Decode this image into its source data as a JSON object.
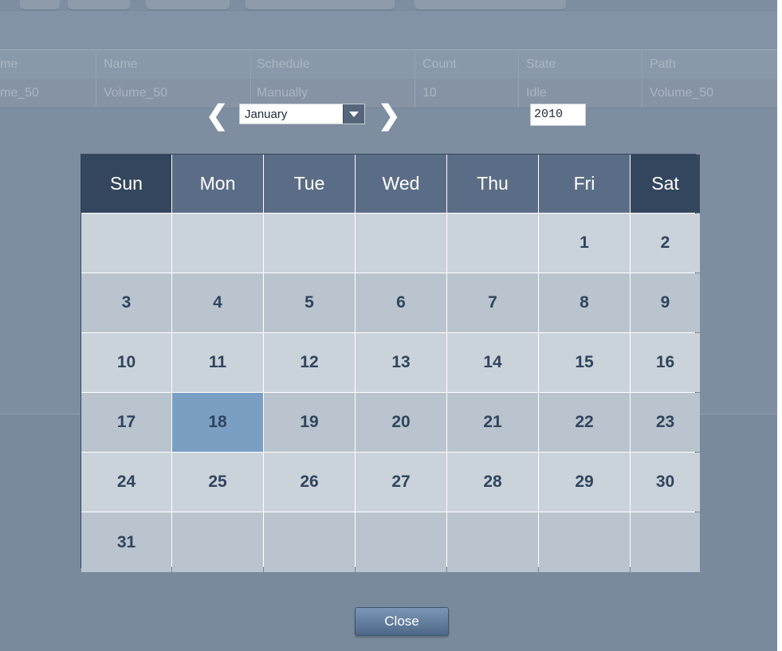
{
  "background": {
    "table": {
      "columns": [
        "me",
        "Name",
        "Schedule",
        "Count",
        "State",
        "Path"
      ],
      "row": [
        "me_50",
        "Volume_50",
        "Manually",
        "10",
        "Idle",
        "Volume_50"
      ]
    }
  },
  "datepicker": {
    "prev_icon": "chevron-left-icon",
    "next_icon": "chevron-right-icon",
    "month": "January",
    "year": "2010",
    "weekdays": [
      "Sun",
      "Mon",
      "Tue",
      "Wed",
      "Thu",
      "Fri",
      "Sat"
    ],
    "weeks": [
      [
        "",
        "",
        "",
        "",
        "",
        "1",
        "2"
      ],
      [
        "3",
        "4",
        "5",
        "6",
        "7",
        "8",
        "9"
      ],
      [
        "10",
        "11",
        "12",
        "13",
        "14",
        "15",
        "16"
      ],
      [
        "17",
        "18",
        "19",
        "20",
        "21",
        "22",
        "23"
      ],
      [
        "24",
        "25",
        "26",
        "27",
        "28",
        "29",
        "30"
      ],
      [
        "31",
        "",
        "",
        "",
        "",
        "",
        ""
      ]
    ],
    "selected_day": "18",
    "close_label": "Close"
  },
  "colors": {
    "header_weekday": "#5b6d86",
    "header_weekend": "#34465e",
    "cell_light": "#cbd3da",
    "cell_dark": "#b9c4ce",
    "selected": "#7b9fc3",
    "day_text": "#30445e"
  }
}
